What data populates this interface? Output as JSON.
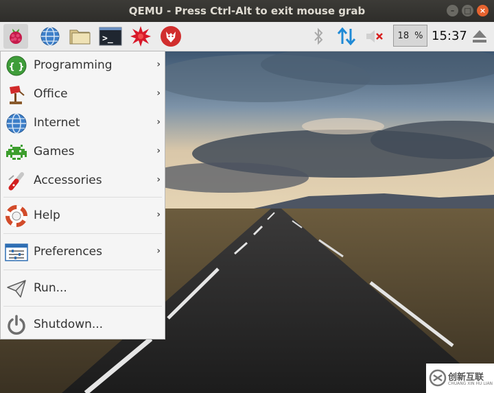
{
  "window": {
    "title": "QEMU - Press Ctrl-Alt to exit mouse grab",
    "minimize_glyph": "–",
    "maximize_glyph": "□",
    "close_glyph": "×"
  },
  "taskbar": {
    "launchers": [
      "raspberry-menu-icon",
      "web-browser-icon",
      "file-manager-icon",
      "terminal-icon",
      "mathematica-icon",
      "wolfram-icon"
    ],
    "terminal_prompt": ">_",
    "cpu_percent": "18",
    "cpu_unit": "%",
    "clock": "15:37"
  },
  "menu": {
    "items": [
      {
        "label": "Programming",
        "icon": "programming-icon",
        "submenu_arrow": "›"
      },
      {
        "label": "Office",
        "icon": "office-icon",
        "submenu_arrow": "›"
      },
      {
        "label": "Internet",
        "icon": "internet-icon",
        "submenu_arrow": "›"
      },
      {
        "label": "Games",
        "icon": "games-icon",
        "submenu_arrow": "›"
      },
      {
        "label": "Accessories",
        "icon": "accessories-icon",
        "submenu_arrow": "›"
      },
      {
        "label": "Help",
        "icon": "help-icon",
        "submenu_arrow": "›"
      },
      {
        "label": "Preferences",
        "icon": "preferences-icon",
        "submenu_arrow": "›"
      },
      {
        "label": "Run...",
        "icon": "run-icon"
      },
      {
        "label": "Shutdown...",
        "icon": "shutdown-icon"
      }
    ],
    "programming_glyph": "{ }"
  },
  "watermark": {
    "text": "创新互联",
    "sub": "CHUANG XIN HU LIAN"
  },
  "colors": {
    "titlebar": "#2e2d2a",
    "close_button": "#e6632f",
    "network_arrows": "#1f8ad6",
    "raspberry": "#c51a4a"
  }
}
